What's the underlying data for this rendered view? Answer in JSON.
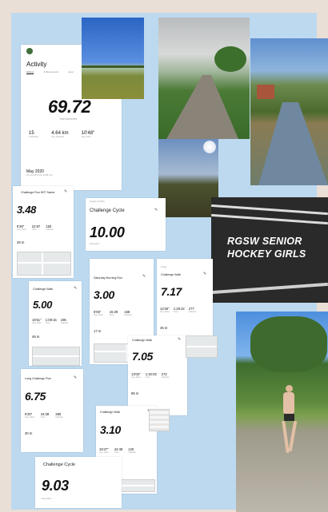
{
  "colors": {
    "board": "#bcd9ef",
    "avatar": "#3f6f3b",
    "road_text": "#ffffff"
  },
  "activity": {
    "title": "Activity",
    "tabs": [
      "History",
      "Achievements",
      "Gear"
    ],
    "total": "69.72",
    "total_label": "Total kilometres",
    "stats": [
      {
        "v": "15",
        "l": "Total Runs"
      },
      {
        "v": "4.64 km",
        "l": "Avg. Distance"
      },
      {
        "v": "10'48\"",
        "l": "Avg. Pace"
      }
    ],
    "month": "May 2020",
    "month_sub": "15 runs  69.72 km  10'48\" /km"
  },
  "run1": {
    "title": "Challenge Run HET Name",
    "value": "3.48",
    "stats": [
      {
        "v": "6'36\"",
        "l": "Avg. Pace"
      },
      {
        "v": "22:57",
        "l": "Time"
      },
      {
        "v": "150",
        "l": "Calories"
      }
    ],
    "elev": "28 m"
  },
  "cycle1": {
    "date": "Sunday 3rd May",
    "title": "Challenge Cycle",
    "value": "10.00",
    "unit": "Kilometres"
  },
  "walk1": {
    "title": "Challenge Walk",
    "value": "5.00",
    "stats": [
      {
        "v": "15'51\"",
        "l": "Avg. Pace"
      },
      {
        "v": "1:08:15",
        "l": "Time"
      },
      {
        "v": "195",
        "l": "Calories"
      }
    ],
    "elev": "48 m"
  },
  "sat": {
    "title": "Saturday Morning Run",
    "value": "3.00",
    "stats": [
      {
        "v": "5'06\"",
        "l": "Avg. Pace"
      },
      {
        "v": "15:29",
        "l": "Time"
      },
      {
        "v": "168",
        "l": "Calories"
      }
    ],
    "elev": "17 m"
  },
  "walk2": {
    "date": "Friday",
    "title": "Challenge Walk",
    "value": "7.17",
    "stats": [
      {
        "v": "12'26\"",
        "l": "Avg. Pace"
      },
      {
        "v": "1:29:22",
        "l": "Time"
      },
      {
        "v": "277",
        "l": "Calories"
      }
    ],
    "elev": "45 m"
  },
  "walk3": {
    "title": "Challenge Walk",
    "value": "7.05",
    "stats": [
      {
        "v": "13'03\"",
        "l": "Avg. Pace"
      },
      {
        "v": "1:32:03",
        "l": "Time"
      },
      {
        "v": "272",
        "l": "Calories"
      }
    ],
    "elev": "86 m"
  },
  "long": {
    "title": "Long Challenge Run",
    "value": "6.75",
    "stats": [
      {
        "v": "6'30\"",
        "l": "Avg. Pace"
      },
      {
        "v": "44:28",
        "l": "Time"
      },
      {
        "v": "380",
        "l": "Calories"
      }
    ],
    "elev": "30 m"
  },
  "walk4": {
    "title": "Challenge Walk",
    "value": "3.10",
    "stats": [
      {
        "v": "15'47\"",
        "l": "Avg. Pace"
      },
      {
        "v": "42:48",
        "l": "Time"
      },
      {
        "v": "120",
        "l": "Calories"
      }
    ],
    "elev": "8 m"
  },
  "cycle2": {
    "title": "Challenge Cycle",
    "value": "9.03",
    "unit": "Kilometres"
  },
  "road_text": [
    "RGSW SENIOR",
    "HOCKEY GIRLS"
  ]
}
